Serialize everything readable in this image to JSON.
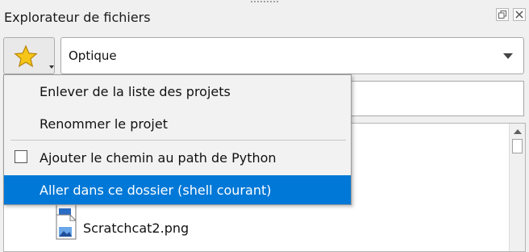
{
  "pane": {
    "title": "Explorateur de fichiers"
  },
  "project_combo": {
    "value": "Optique"
  },
  "menu": {
    "remove_label": "Enlever de la liste des projets",
    "rename_label": "Renommer le projet",
    "add_path_label": "Ajouter le chemin au path de Python",
    "add_path_checked": false,
    "goto_label": "Aller dans ce dossier (shell courant)"
  },
  "files": [
    {
      "name": "Scratchcat2.png"
    }
  ],
  "colors": {
    "highlight": "#0078d7",
    "star": "#f5c518"
  }
}
